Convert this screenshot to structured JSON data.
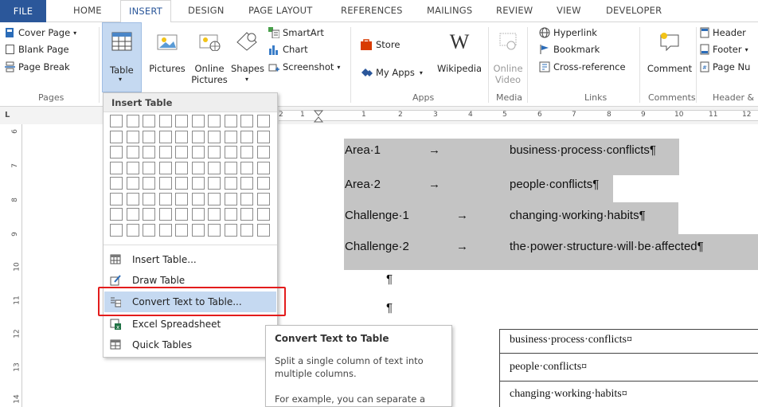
{
  "tabs": [
    "FILE",
    "HOME",
    "INSERT",
    "DESIGN",
    "PAGE LAYOUT",
    "REFERENCES",
    "MAILINGS",
    "REVIEW",
    "VIEW",
    "DEVELOPER"
  ],
  "ribbon": {
    "pages": {
      "cover_page": "Cover Page",
      "blank_page": "Blank Page",
      "page_break": "Page Break",
      "label": "Pages"
    },
    "table": {
      "label": "Table"
    },
    "illustrations": {
      "pictures": "Pictures",
      "online_pictures_1": "Online",
      "online_pictures_2": "Pictures",
      "shapes": "Shapes",
      "smartart": "SmartArt",
      "chart": "Chart",
      "screenshot": "Screenshot"
    },
    "apps": {
      "store": "Store",
      "my_apps": "My Apps",
      "wikipedia": "Wikipedia",
      "label": "Apps"
    },
    "media": {
      "online_video_1": "Online",
      "online_video_2": "Video",
      "label": "Media"
    },
    "links": {
      "hyperlink": "Hyperlink",
      "bookmark": "Bookmark",
      "cross_reference": "Cross-reference",
      "label": "Links"
    },
    "comments": {
      "comment": "Comment",
      "label": "Comments"
    },
    "header_footer": {
      "header": "Header",
      "footer": "Footer",
      "page_number": "Page Nu",
      "label": "Header &"
    }
  },
  "ruler": {
    "ticks": [
      "2",
      "1",
      "1",
      "2",
      "3",
      "4",
      "5",
      "6",
      "7",
      "8",
      "9",
      "10",
      "11",
      "12"
    ],
    "vertical": [
      "6",
      "7",
      "8",
      "9",
      "10",
      "11",
      "12",
      "13",
      "14"
    ]
  },
  "document": {
    "lines": [
      {
        "a": "Area·1",
        "b": "business·process·conflicts¶"
      },
      {
        "a": "Area·2",
        "b": "people·conflicts¶"
      },
      {
        "a": "Challenge·1",
        "b": "changing·working·habits¶"
      },
      {
        "a": "Challenge·2",
        "b": "the·power·structure·will·be·affected¶"
      }
    ],
    "arrow": "→",
    "pilcrow": "¶",
    "table_cells": [
      "business·process·conflicts¤",
      "people·conflicts¤",
      "changing·working·habits¤"
    ]
  },
  "dropdown": {
    "header": "Insert Table",
    "items": [
      {
        "label": "Insert Table...",
        "icon": "insert-table-icon"
      },
      {
        "label": "Draw Table",
        "icon": "draw-table-icon"
      },
      {
        "label": "Convert Text to Table...",
        "icon": "convert-text-icon"
      },
      {
        "label": "Excel Spreadsheet",
        "icon": "excel-icon"
      },
      {
        "label": "Quick Tables",
        "icon": "quick-tables-icon"
      }
    ],
    "highlight_color": "#e31c1c"
  },
  "tooltip": {
    "title": "Convert Text to Table",
    "line1": "Split a single column of text into",
    "line2": "multiple columns.",
    "line3": "For example, you can separate a"
  }
}
